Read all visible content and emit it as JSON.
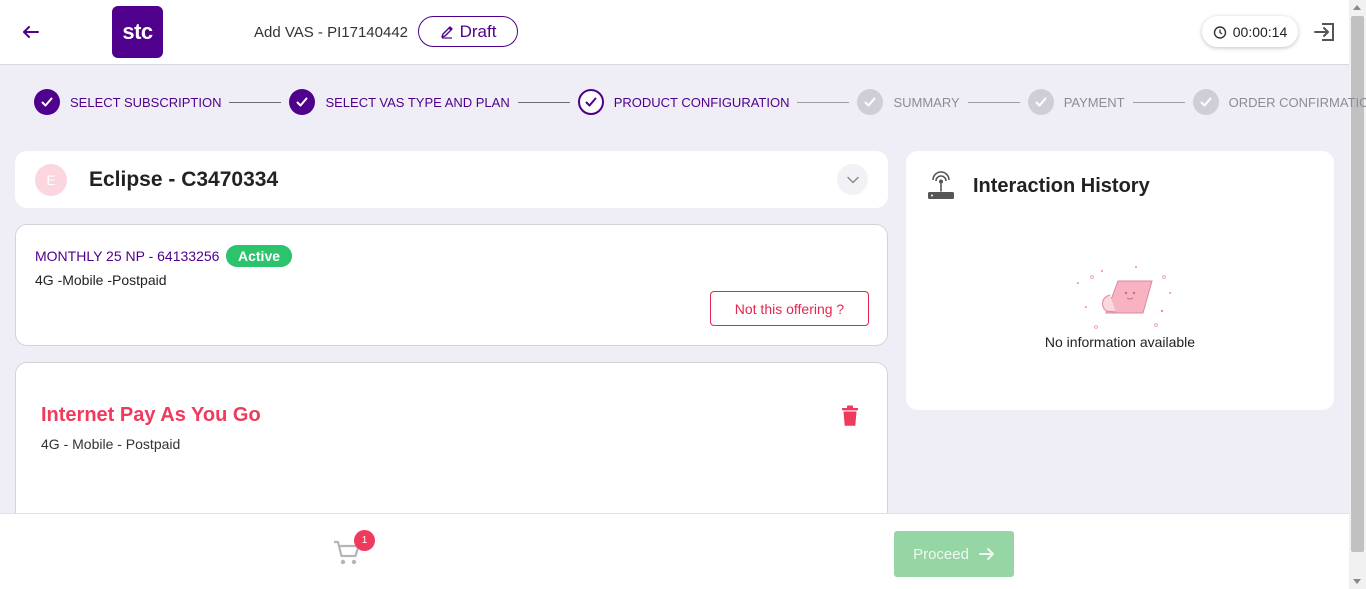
{
  "header": {
    "title": "Add VAS - PI17140442",
    "logo_text": "stc",
    "draft_label": "Draft",
    "timer": "00:00:14"
  },
  "stepper": {
    "steps": [
      {
        "label": "SELECT SUBSCRIPTION",
        "state": "done"
      },
      {
        "label": "SELECT VAS TYPE AND PLAN",
        "state": "done"
      },
      {
        "label": "PRODUCT CONFIGURATION",
        "state": "current"
      },
      {
        "label": "SUMMARY",
        "state": "pending"
      },
      {
        "label": "PAYMENT",
        "state": "pending"
      },
      {
        "label": "ORDER CONFIRMATION",
        "state": "pending"
      }
    ]
  },
  "customer": {
    "initial": "E",
    "name": "Eclipse - C3470334"
  },
  "subscription": {
    "plan_name": "MONTHLY 25 NP - 64133256",
    "status": "Active",
    "plan_type": "4G -Mobile -Postpaid",
    "not_offering_label": "Not this offering ?"
  },
  "vas": {
    "title": "Internet Pay As You Go",
    "subtitle": "4G - Mobile - Postpaid"
  },
  "history": {
    "title": "Interaction History",
    "empty_text": "No information available"
  },
  "footer": {
    "cart_count": "1",
    "proceed_label": "Proceed"
  },
  "colors": {
    "brand": "#4f008c",
    "accent_red": "#ef3a5d",
    "active_green": "#2bc46d",
    "proceed_disabled": "#96d6a4"
  }
}
